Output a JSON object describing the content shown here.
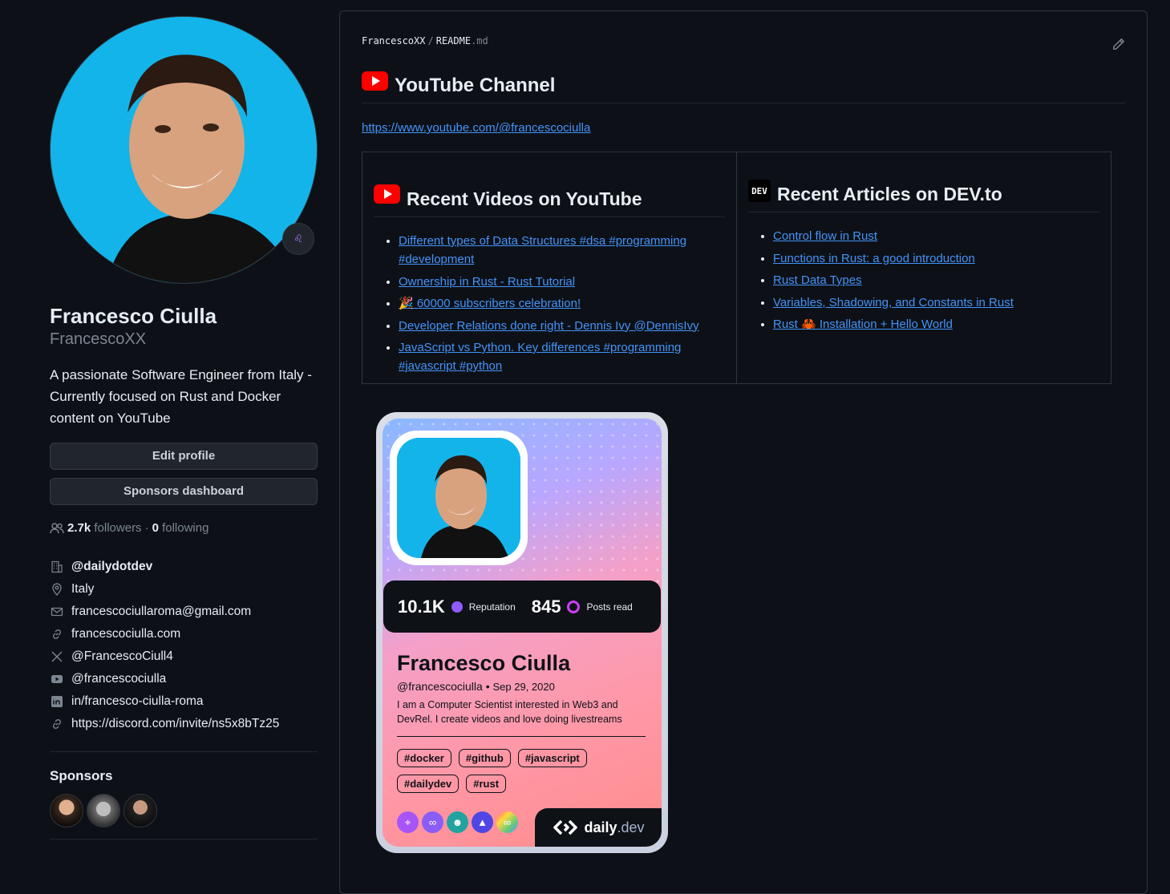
{
  "profile": {
    "full_name": "Francesco Ciulla",
    "username": "FrancescoXX",
    "bio": "A passionate Software Engineer from Italy - Currently focused on Rust and Docker content on YouTube",
    "edit_profile": "Edit profile",
    "sponsors_dashboard": "Sponsors dashboard",
    "followers_count": "2.7k",
    "followers_label": "followers",
    "separator": "·",
    "following_count": "0",
    "following_label": "following",
    "details": [
      {
        "icon": "organization-icon",
        "text": "@dailydotdev"
      },
      {
        "icon": "location-icon",
        "text": "Italy"
      },
      {
        "icon": "mail-icon",
        "text": "francescociullaroma@gmail.com"
      },
      {
        "icon": "link-icon",
        "text": "francescociulla.com"
      },
      {
        "icon": "x-icon",
        "text": "@FrancescoCiull4"
      },
      {
        "icon": "youtube-icon",
        "text": "@francescociulla"
      },
      {
        "icon": "linkedin-icon",
        "text": "in/francesco-ciulla-roma"
      },
      {
        "icon": "link-icon",
        "text": "https://discord.com/invite/ns5x8bTz25"
      }
    ],
    "sponsors_title": "Sponsors"
  },
  "readme": {
    "owner": "FrancescoXX",
    "slash": "/",
    "file": "README",
    "ext": ".md",
    "heading": "YouTube Channel",
    "channel_link": "https://www.youtube.com/@francescociulla",
    "videos_heading": "Recent Videos on YouTube",
    "videos": [
      "Different types of Data Structures #dsa #programming #development",
      "Ownership in Rust - Rust Tutorial",
      "🎉 60000 subscribers celebration!",
      "Developer Relations done right - Dennis Ivy @DennisIvy",
      "JavaScript vs Python. Key differences #programming #javascript #python"
    ],
    "dev_badge": "DEV",
    "articles_heading": "Recent Articles on DEV.to",
    "articles": [
      "Control flow in Rust",
      "Functions in Rust: a good introduction",
      "Rust Data Types",
      "Variables, Shadowing, and Constants in Rust",
      "Rust 🦀 Installation + Hello World"
    ]
  },
  "devcard": {
    "reputation": "10.1K",
    "reputation_label": "Reputation",
    "posts_read": "845",
    "posts_read_label": "Posts read",
    "name": "Francesco Ciulla",
    "handle": "@francescociulla",
    "dot": "•",
    "joined": "Sep 29, 2020",
    "bio": "I am a Computer Scientist interested in Web3 and DevRel. I create videos and love doing livestreams",
    "tags": [
      "#docker",
      "#github",
      "#javascript",
      "#dailydev",
      "#rust"
    ],
    "brand": "daily",
    "brand_suffix": ".dev"
  },
  "colors": {
    "background": "#0d1117",
    "link": "#4493f8",
    "muted": "#7d8590",
    "youtube": "#ff0000"
  }
}
